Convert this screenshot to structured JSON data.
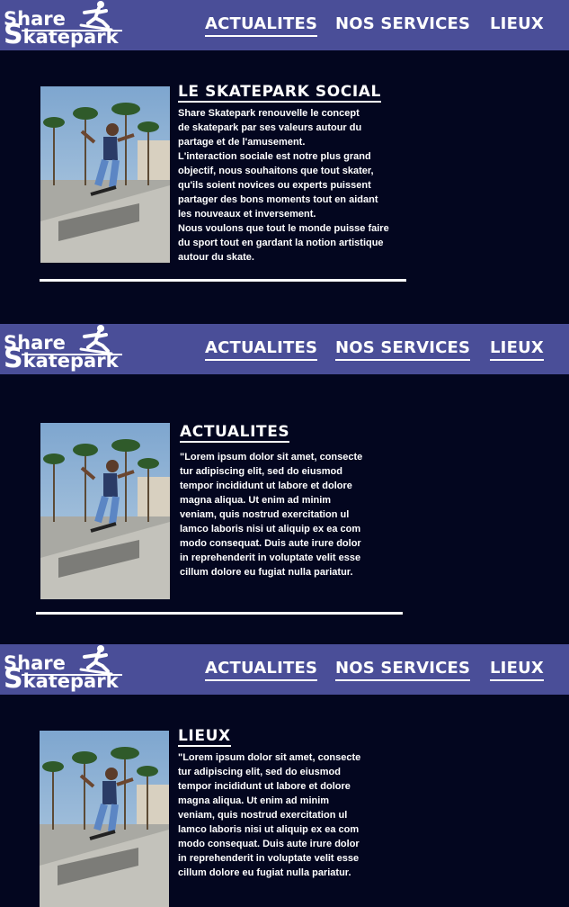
{
  "logo": {
    "line1": "Share",
    "line2_initial": "S",
    "line2_rest": "katepark"
  },
  "nav": {
    "actualites": "ACTUALITES",
    "services": "NOS SERVICES",
    "lieux": "LIEUX"
  },
  "sections": [
    {
      "heading": "LE SKATEPARK SOCIAL",
      "text": "Share Skatepark renouvelle le concept\nde skatepark par ses valeurs autour du\npartage et de l'amusement.\nL'interaction sociale est notre plus  grand\nobjectif, nous souhaitons que tout skater,\nqu'ils soient novices ou experts puissent\npartager des bons moments tout en aidant\nles nouveaux et inversement.\nNous voulons que tout le monde puisse faire\ndu sport  tout en gardant la notion artistique\nautour du skate."
    },
    {
      "heading": "ACTUALITES",
      "text": "\"Lorem ipsum dolor sit amet, consecte\ntur adipiscing elit, sed do eiusmod\ntempor incididunt ut labore et dolore\nmagna aliqua. Ut enim ad minim\nveniam, quis nostrud exercitation ul\nlamco laboris nisi ut aliquip ex ea com\nmodo consequat. Duis aute irure dolor\nin reprehenderit in voluptate velit esse\ncillum dolore eu fugiat nulla pariatur."
    },
    {
      "heading": "LIEUX",
      "text": "\"Lorem ipsum dolor sit amet, consecte\ntur adipiscing elit, sed do eiusmod\ntempor incididunt ut labore et dolore\nmagna aliqua. Ut enim ad minim\nveniam, quis nostrud exercitation ul\nlamco laboris nisi ut aliquip ex ea com\nmodo consequat. Duis aute irure dolor\nin reprehenderit in voluptate velit esse\ncillum dolore eu fugiat nulla pariatur."
    }
  ],
  "icons": {
    "logo_figure": "skater-icon",
    "photo": "skater-photo"
  },
  "colors": {
    "background": "#03061f",
    "navbar": "#4a4e98",
    "text": "#ffffff"
  }
}
